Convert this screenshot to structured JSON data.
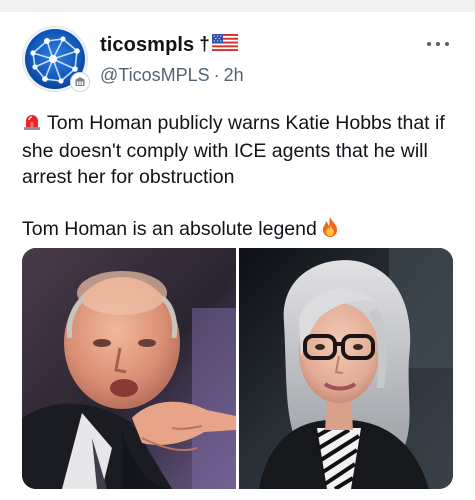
{
  "post": {
    "display_name": "ticosmpls",
    "name_suffix_cross": "†",
    "name_suffix_flag": "us-flag-emoji",
    "handle": "@TicosMPLS",
    "separator": "·",
    "timestamp": "2h",
    "text_line_1": "Tom Homan publicly warns Katie Hobbs that if she doesn't comply with ICE agents that he will arrest her for obstruction",
    "text_line_1_icon": "police-siren-emoji",
    "text_line_2": "Tom Homan is an absolute legend",
    "text_line_2_icon": "fire-emoji",
    "media": {
      "count": 2,
      "images": [
        {
          "subject": "man pointing at camera"
        },
        {
          "subject": "woman with gray hair and glasses"
        }
      ]
    }
  },
  "icons": {
    "avatar": "network-globe-avatar",
    "badge": "affiliate-badge-icon",
    "more": "more-options-icon"
  },
  "colors": {
    "text_primary": "#0f1419",
    "text_secondary": "#536471",
    "background": "#ffffff",
    "top_strip": "#eff1f3"
  }
}
